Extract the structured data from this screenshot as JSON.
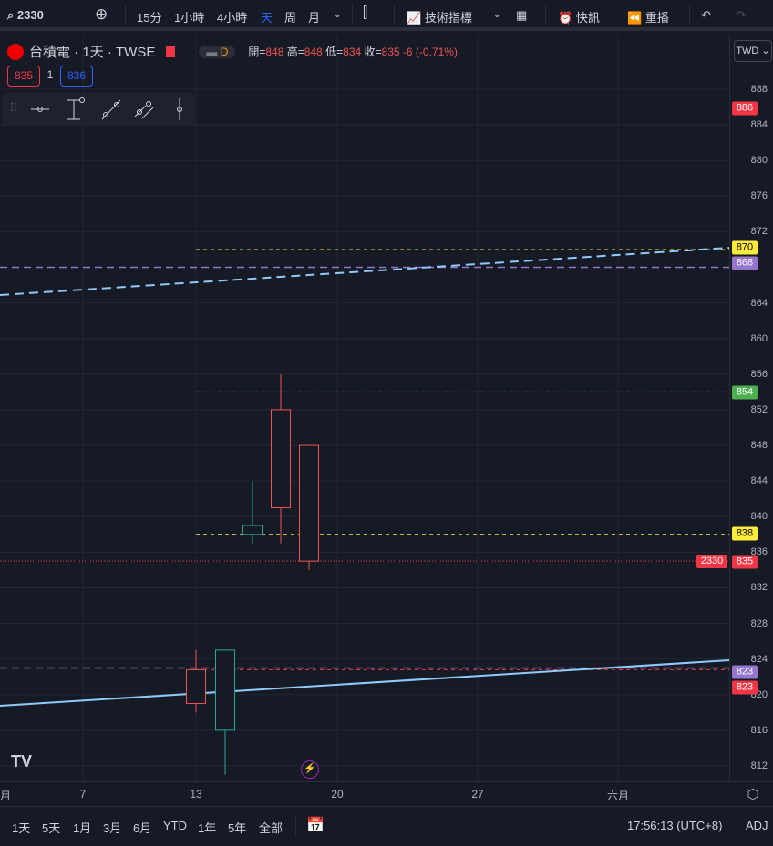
{
  "toolbar": {
    "symbol": "2330",
    "intervals": [
      "15分",
      "1小時",
      "4小時",
      "天",
      "周",
      "月"
    ],
    "indicators": "技術指標",
    "alerts": "快訊",
    "replay": "重播"
  },
  "legend": {
    "name": "台積電 · 1天 · TWSE",
    "badge": "D",
    "open_label": "開=",
    "open": "848",
    "high_label": "高=",
    "high": "848",
    "low_label": "低=",
    "low": "834",
    "close_label": "收=",
    "close": "835",
    "change": "-6 (-0.71%)",
    "sell": "835",
    "spread": "1",
    "buy": "836"
  },
  "currency": "TWD",
  "price_ticks": [
    "888",
    "884",
    "880",
    "876",
    "872",
    "864",
    "860",
    "856",
    "852",
    "848",
    "844",
    "840",
    "836",
    "832",
    "828",
    "824",
    "820",
    "816",
    "812"
  ],
  "price_tags": [
    {
      "v": "886",
      "c": "#f23645",
      "tc": "#fff"
    },
    {
      "v": "870",
      "c": "#ffeb3b",
      "tc": "#000"
    },
    {
      "v": "868",
      "c": "#9575cd",
      "tc": "#fff"
    },
    {
      "v": "854",
      "c": "#4caf50",
      "tc": "#fff"
    },
    {
      "v": "838",
      "c": "#ffeb3b",
      "tc": "#000"
    },
    {
      "v": "835",
      "c": "#f23645",
      "tc": "#fff"
    },
    {
      "v": "823",
      "c": "#9575cd",
      "tc": "#fff"
    },
    {
      "v": "823",
      "c": "#f23645",
      "tc": "#fff"
    }
  ],
  "symbol_tag": "2330",
  "chart_data": {
    "type": "candlestick",
    "candles": [
      {
        "date": "13",
        "o": 819,
        "h": 825,
        "l": 818,
        "c": 822.8,
        "color": "red"
      },
      {
        "date": "14",
        "o": 825,
        "h": 825,
        "l": 811,
        "c": 816,
        "color": "teal"
      },
      {
        "date": "15",
        "o": 838,
        "h": 844,
        "l": 837,
        "c": 839,
        "color": "teal"
      },
      {
        "date": "16",
        "o": 841,
        "h": 856,
        "l": 837,
        "c": 852,
        "color": "red"
      },
      {
        "date": "17",
        "o": 848,
        "h": 848,
        "l": 834,
        "c": 835,
        "color": "red"
      }
    ],
    "ylim": [
      811,
      890
    ],
    "hlines": [
      {
        "v": 886,
        "c": "#f23645"
      },
      {
        "v": 870,
        "c": "#ffeb3b"
      },
      {
        "v": 868,
        "c": "#9575cd",
        "long": true
      },
      {
        "v": 854,
        "c": "#4caf50"
      },
      {
        "v": 838,
        "c": "#ffeb3b"
      },
      {
        "v": 823,
        "c": "#9575cd",
        "long": true
      },
      {
        "v": 822.8,
        "c": "#f23645"
      }
    ]
  },
  "x_ticks": [
    "月",
    "7",
    "13",
    "20",
    "27",
    "六月"
  ],
  "ranges": [
    "1天",
    "5天",
    "1月",
    "3月",
    "6月",
    "YTD",
    "1年",
    "5年",
    "全部"
  ],
  "time": "17:56:13 (UTC+8)",
  "adj": "ADJ"
}
